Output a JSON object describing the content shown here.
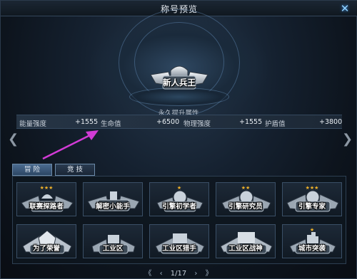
{
  "window": {
    "title": "称号预览",
    "close_icon": "close-icon"
  },
  "preview": {
    "badge_label": "新人兵王"
  },
  "stats": {
    "title": "永久提升属性",
    "items": [
      {
        "name": "能量强度",
        "value": "+1555"
      },
      {
        "name": "生命值",
        "value": "+6500"
      },
      {
        "name": "物理强度",
        "value": "+1555"
      },
      {
        "name": "护盾值",
        "value": "+3800"
      }
    ]
  },
  "tabs": [
    {
      "label": "冒 险",
      "active": true
    },
    {
      "label": "竞 技",
      "active": false
    }
  ],
  "titles": [
    {
      "label": "联赛探路者"
    },
    {
      "label": "解密小能手"
    },
    {
      "label": "引擎初学者"
    },
    {
      "label": "引擎研究员"
    },
    {
      "label": "引擎专家"
    },
    {
      "label": "为了荣誉"
    },
    {
      "label": "工业区"
    },
    {
      "label": "工业区猎手"
    },
    {
      "label": "工业区战神"
    },
    {
      "label": "城市突袭"
    }
  ],
  "pagination": {
    "first": "《",
    "prev": "‹",
    "page": "1/17",
    "next": "›",
    "last": "》"
  },
  "colors": {
    "accent": "#6c8aa8",
    "star": "#f2b32a",
    "pointer": "#d23bd6"
  }
}
